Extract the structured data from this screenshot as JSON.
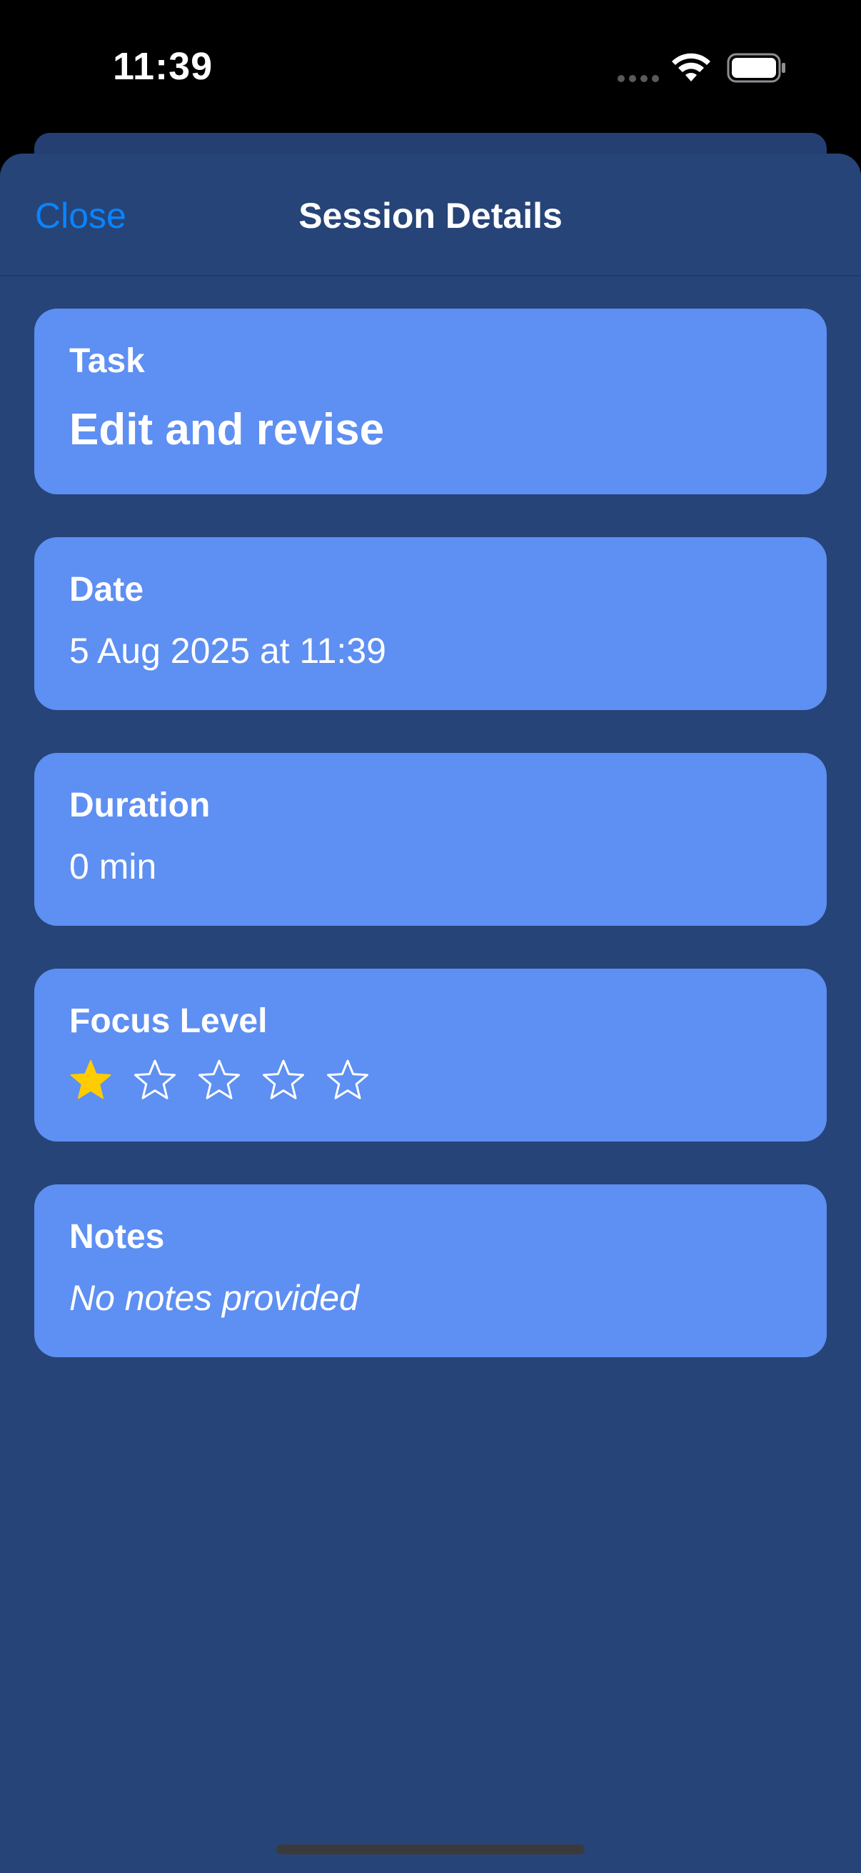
{
  "status_bar": {
    "time": "11:39"
  },
  "nav": {
    "close_label": "Close",
    "title": "Session Details"
  },
  "cards": {
    "task": {
      "label": "Task",
      "value": "Edit and revise"
    },
    "date": {
      "label": "Date",
      "value": "5 Aug 2025 at 11:39"
    },
    "duration": {
      "label": "Duration",
      "value": "0 min"
    },
    "focus": {
      "label": "Focus Level",
      "rating": 1,
      "max_rating": 5
    },
    "notes": {
      "label": "Notes",
      "value": "No notes provided"
    }
  },
  "colors": {
    "background": "#264478",
    "card": "#5e8ff2",
    "accent": "#0a84ff",
    "star_filled": "#ffcc00"
  },
  "icons": [
    "wifi-icon",
    "battery-icon",
    "cellular-dots-icon",
    "star-icon"
  ]
}
